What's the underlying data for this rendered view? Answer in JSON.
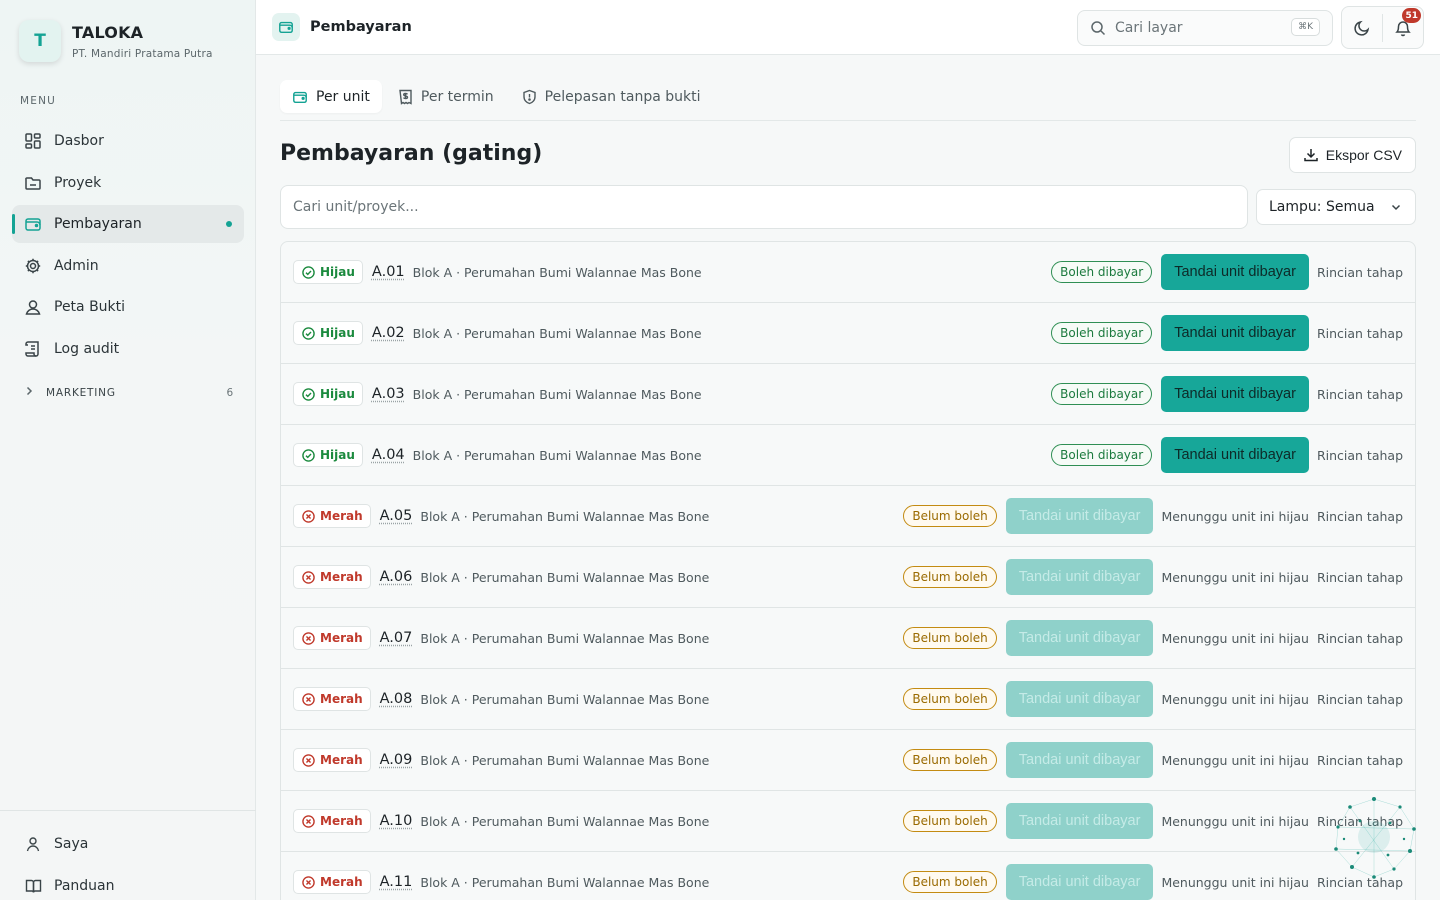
{
  "brand": {
    "logo_letter": "T",
    "name": "TALOKA",
    "company": "PT. Mandiri Pratama Putra"
  },
  "sidebar": {
    "menu_label": "MENU",
    "items": [
      {
        "label": "Dasbor",
        "icon": "dashboard-icon"
      },
      {
        "label": "Proyek",
        "icon": "folder-icon"
      },
      {
        "label": "Pembayaran",
        "icon": "wallet-icon",
        "active": true
      },
      {
        "label": "Admin",
        "icon": "gear-icon"
      },
      {
        "label": "Peta Bukti",
        "icon": "user-pin-icon"
      },
      {
        "label": "Log audit",
        "icon": "scroll-icon"
      }
    ],
    "group": {
      "label": "MARKETING",
      "count": "6"
    },
    "bottom": [
      {
        "label": "Saya",
        "icon": "user-icon"
      },
      {
        "label": "Panduan",
        "icon": "book-icon"
      }
    ]
  },
  "topbar": {
    "title": "Pembayaran",
    "search_placeholder": "Cari layar",
    "search_shortcut": "⌘K",
    "notification_count": "51"
  },
  "tabs": [
    {
      "label": "Per unit",
      "icon": "wallet-icon",
      "active": true
    },
    {
      "label": "Per termin",
      "icon": "receipt-icon"
    },
    {
      "label": "Pelepasan tanpa bukti",
      "icon": "shield-icon"
    }
  ],
  "page": {
    "title": "Pembayaran (gating)",
    "export_label": "Ekspor CSV",
    "search_placeholder": "Cari unit/proyek...",
    "filter_label": "Lampu: Semua"
  },
  "labels": {
    "green_lamp": "Hijau",
    "red_lamp": "Merah",
    "status_ok": "Boleh dibayar",
    "status_no": "Belum boleh",
    "mark_button": "Tandai unit dibayar",
    "waiting": "Menunggu unit ini hijau",
    "detail": "Rincian tahap"
  },
  "colors": {
    "accent": "#17a799",
    "green": "#1b8a3e",
    "red": "#c0392b",
    "amber": "#c38b12"
  },
  "units": [
    {
      "code": "A.01",
      "desc": "Blok A · Perumahan Bumi Walannae Mas Bone",
      "lamp": "green"
    },
    {
      "code": "A.02",
      "desc": "Blok A · Perumahan Bumi Walannae Mas Bone",
      "lamp": "green"
    },
    {
      "code": "A.03",
      "desc": "Blok A · Perumahan Bumi Walannae Mas Bone",
      "lamp": "green"
    },
    {
      "code": "A.04",
      "desc": "Blok A · Perumahan Bumi Walannae Mas Bone",
      "lamp": "green"
    },
    {
      "code": "A.05",
      "desc": "Blok A · Perumahan Bumi Walannae Mas Bone",
      "lamp": "red"
    },
    {
      "code": "A.06",
      "desc": "Blok A · Perumahan Bumi Walannae Mas Bone",
      "lamp": "red"
    },
    {
      "code": "A.07",
      "desc": "Blok A · Perumahan Bumi Walannae Mas Bone",
      "lamp": "red"
    },
    {
      "code": "A.08",
      "desc": "Blok A · Perumahan Bumi Walannae Mas Bone",
      "lamp": "red"
    },
    {
      "code": "A.09",
      "desc": "Blok A · Perumahan Bumi Walannae Mas Bone",
      "lamp": "red"
    },
    {
      "code": "A.10",
      "desc": "Blok A · Perumahan Bumi Walannae Mas Bone",
      "lamp": "red"
    },
    {
      "code": "A.11",
      "desc": "Blok A · Perumahan Bumi Walannae Mas Bone",
      "lamp": "red"
    }
  ]
}
